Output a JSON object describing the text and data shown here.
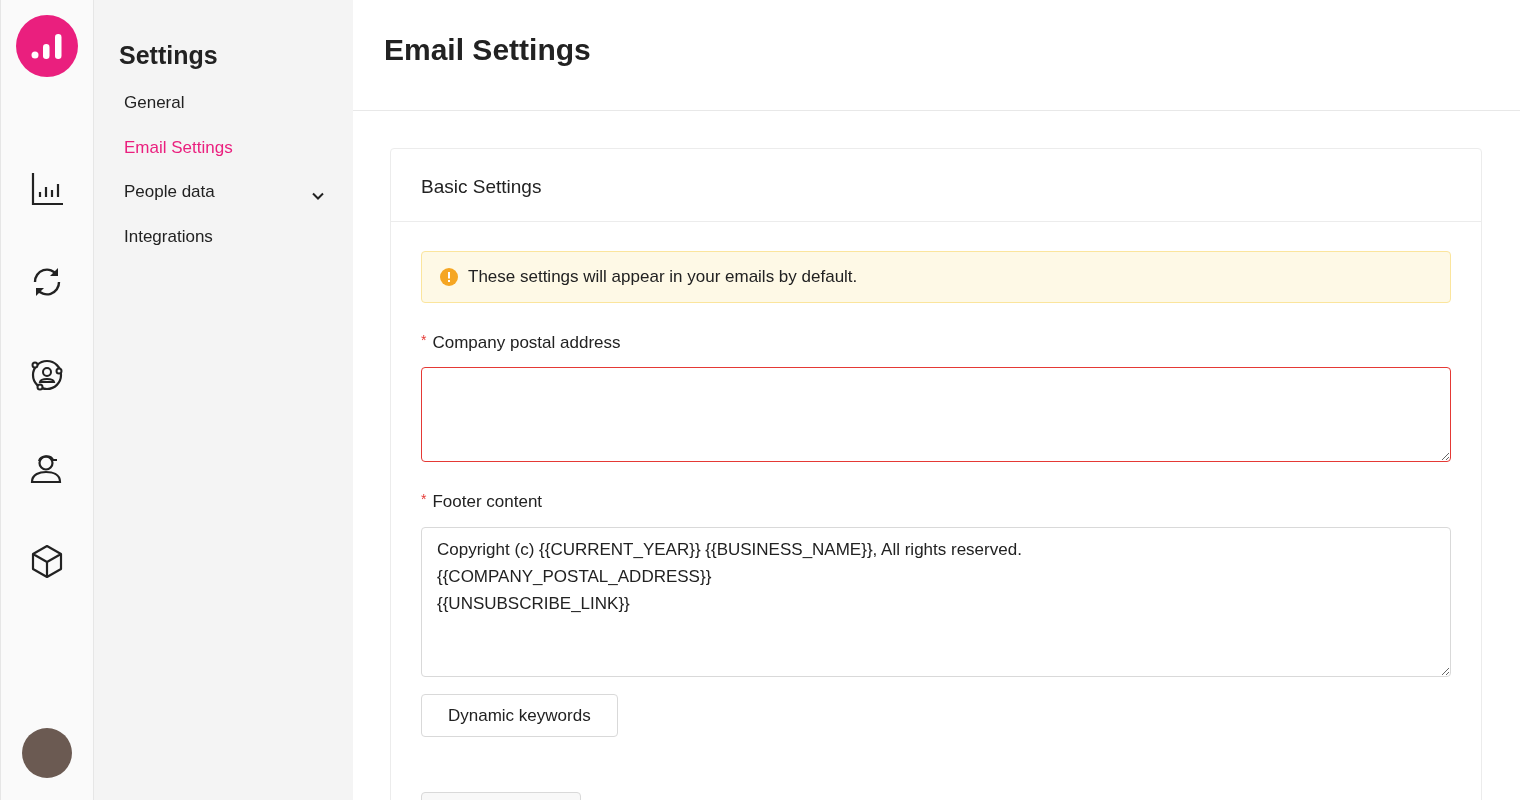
{
  "rail": {
    "items": [
      {
        "kind": "chart",
        "selected": false
      },
      {
        "kind": "sync",
        "selected": false
      },
      {
        "kind": "contacts",
        "selected": false
      },
      {
        "kind": "agent",
        "selected": false
      },
      {
        "kind": "box",
        "selected": false
      }
    ]
  },
  "sidebar": {
    "title": "Settings",
    "items": [
      {
        "label": "General",
        "selected": false,
        "expandable": false
      },
      {
        "label": "Email Settings",
        "selected": true,
        "expandable": false
      },
      {
        "label": "People data",
        "selected": false,
        "expandable": true
      },
      {
        "label": "Integrations",
        "selected": false,
        "expandable": false
      }
    ]
  },
  "page": {
    "title": "Email Settings"
  },
  "card": {
    "title": "Basic Settings",
    "notice": "These settings will appear in your emails by default.",
    "fields": [
      {
        "label": "Company postal address",
        "required": true,
        "required_mark": "*",
        "error": true
      },
      {
        "label": "Footer content",
        "required": true,
        "required_mark": "*",
        "error": false,
        "value": "Copyright (c) {{CURRENT_YEAR}} {{BUSINESS_NAME}}, All rights reserved.\n{{COMPANY_POSTAL_ADDRESS}}\n{{UNSUBSCRIBE_LINK}}"
      }
    ],
    "button": "Dynamic keywords"
  }
}
